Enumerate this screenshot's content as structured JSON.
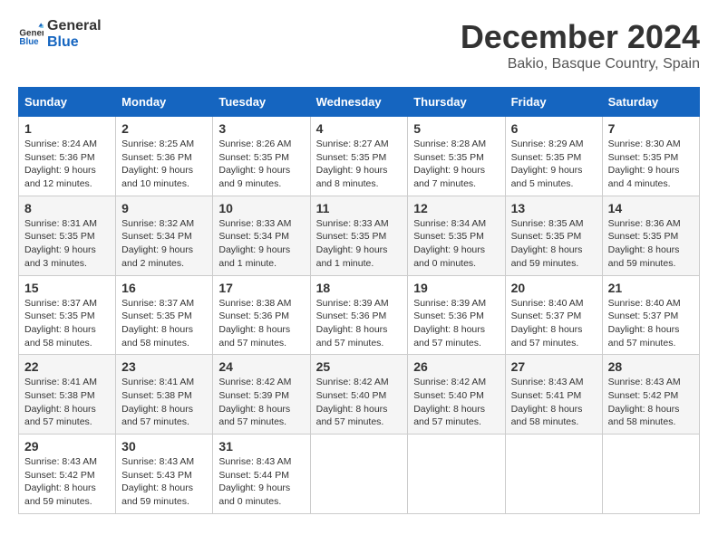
{
  "logo": {
    "general": "General",
    "blue": "Blue"
  },
  "title": {
    "month": "December 2024",
    "location": "Bakio, Basque Country, Spain"
  },
  "headers": [
    "Sunday",
    "Monday",
    "Tuesday",
    "Wednesday",
    "Thursday",
    "Friday",
    "Saturday"
  ],
  "weeks": [
    [
      {
        "day": "1",
        "sunrise": "8:24 AM",
        "sunset": "5:36 PM",
        "daylight": "9 hours and 12 minutes."
      },
      {
        "day": "2",
        "sunrise": "8:25 AM",
        "sunset": "5:36 PM",
        "daylight": "9 hours and 10 minutes."
      },
      {
        "day": "3",
        "sunrise": "8:26 AM",
        "sunset": "5:35 PM",
        "daylight": "9 hours and 9 minutes."
      },
      {
        "day": "4",
        "sunrise": "8:27 AM",
        "sunset": "5:35 PM",
        "daylight": "9 hours and 8 minutes."
      },
      {
        "day": "5",
        "sunrise": "8:28 AM",
        "sunset": "5:35 PM",
        "daylight": "9 hours and 7 minutes."
      },
      {
        "day": "6",
        "sunrise": "8:29 AM",
        "sunset": "5:35 PM",
        "daylight": "9 hours and 5 minutes."
      },
      {
        "day": "7",
        "sunrise": "8:30 AM",
        "sunset": "5:35 PM",
        "daylight": "9 hours and 4 minutes."
      }
    ],
    [
      {
        "day": "8",
        "sunrise": "8:31 AM",
        "sunset": "5:35 PM",
        "daylight": "9 hours and 3 minutes."
      },
      {
        "day": "9",
        "sunrise": "8:32 AM",
        "sunset": "5:34 PM",
        "daylight": "9 hours and 2 minutes."
      },
      {
        "day": "10",
        "sunrise": "8:33 AM",
        "sunset": "5:34 PM",
        "daylight": "9 hours and 1 minute."
      },
      {
        "day": "11",
        "sunrise": "8:33 AM",
        "sunset": "5:35 PM",
        "daylight": "9 hours and 1 minute."
      },
      {
        "day": "12",
        "sunrise": "8:34 AM",
        "sunset": "5:35 PM",
        "daylight": "9 hours and 0 minutes."
      },
      {
        "day": "13",
        "sunrise": "8:35 AM",
        "sunset": "5:35 PM",
        "daylight": "8 hours and 59 minutes."
      },
      {
        "day": "14",
        "sunrise": "8:36 AM",
        "sunset": "5:35 PM",
        "daylight": "8 hours and 59 minutes."
      }
    ],
    [
      {
        "day": "15",
        "sunrise": "8:37 AM",
        "sunset": "5:35 PM",
        "daylight": "8 hours and 58 minutes."
      },
      {
        "day": "16",
        "sunrise": "8:37 AM",
        "sunset": "5:35 PM",
        "daylight": "8 hours and 58 minutes."
      },
      {
        "day": "17",
        "sunrise": "8:38 AM",
        "sunset": "5:36 PM",
        "daylight": "8 hours and 57 minutes."
      },
      {
        "day": "18",
        "sunrise": "8:39 AM",
        "sunset": "5:36 PM",
        "daylight": "8 hours and 57 minutes."
      },
      {
        "day": "19",
        "sunrise": "8:39 AM",
        "sunset": "5:36 PM",
        "daylight": "8 hours and 57 minutes."
      },
      {
        "day": "20",
        "sunrise": "8:40 AM",
        "sunset": "5:37 PM",
        "daylight": "8 hours and 57 minutes."
      },
      {
        "day": "21",
        "sunrise": "8:40 AM",
        "sunset": "5:37 PM",
        "daylight": "8 hours and 57 minutes."
      }
    ],
    [
      {
        "day": "22",
        "sunrise": "8:41 AM",
        "sunset": "5:38 PM",
        "daylight": "8 hours and 57 minutes."
      },
      {
        "day": "23",
        "sunrise": "8:41 AM",
        "sunset": "5:38 PM",
        "daylight": "8 hours and 57 minutes."
      },
      {
        "day": "24",
        "sunrise": "8:42 AM",
        "sunset": "5:39 PM",
        "daylight": "8 hours and 57 minutes."
      },
      {
        "day": "25",
        "sunrise": "8:42 AM",
        "sunset": "5:40 PM",
        "daylight": "8 hours and 57 minutes."
      },
      {
        "day": "26",
        "sunrise": "8:42 AM",
        "sunset": "5:40 PM",
        "daylight": "8 hours and 57 minutes."
      },
      {
        "day": "27",
        "sunrise": "8:43 AM",
        "sunset": "5:41 PM",
        "daylight": "8 hours and 58 minutes."
      },
      {
        "day": "28",
        "sunrise": "8:43 AM",
        "sunset": "5:42 PM",
        "daylight": "8 hours and 58 minutes."
      }
    ],
    [
      {
        "day": "29",
        "sunrise": "8:43 AM",
        "sunset": "5:42 PM",
        "daylight": "8 hours and 59 minutes."
      },
      {
        "day": "30",
        "sunrise": "8:43 AM",
        "sunset": "5:43 PM",
        "daylight": "8 hours and 59 minutes."
      },
      {
        "day": "31",
        "sunrise": "8:43 AM",
        "sunset": "5:44 PM",
        "daylight": "9 hours and 0 minutes."
      },
      null,
      null,
      null,
      null
    ]
  ],
  "labels": {
    "sunrise": "Sunrise:",
    "sunset": "Sunset:",
    "daylight": "Daylight:"
  }
}
